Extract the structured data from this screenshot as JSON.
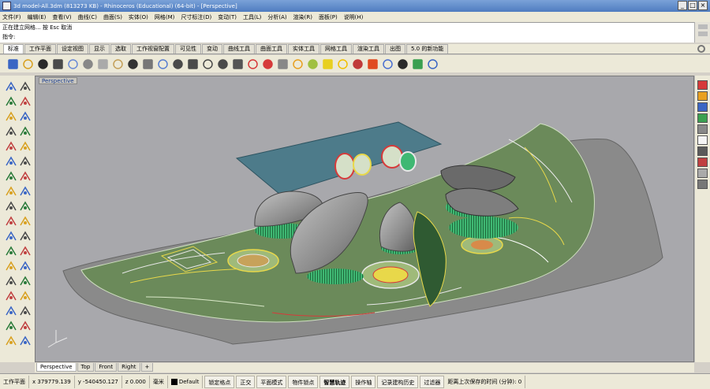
{
  "window": {
    "title": "3d model-All.3dm (813273 KB) - Rhinoceros (Educational) (64-bit) - [Perspective]",
    "controls": [
      "_",
      "□",
      "×"
    ]
  },
  "menu": [
    "文件(F)",
    "编辑(E)",
    "查看(V)",
    "曲线(C)",
    "曲面(S)",
    "实体(O)",
    "网格(M)",
    "尺寸标注(D)",
    "变动(T)",
    "工具(L)",
    "分析(A)",
    "渲染(R)",
    "面板(P)",
    "说明(H)"
  ],
  "command": {
    "history": "正在建立网格... 按 Esc 取消",
    "prompt": "指令:"
  },
  "tabs": [
    "标准",
    "工作平面",
    "设定视图",
    "显示",
    "选取",
    "工作视窗配置",
    "可见性",
    "变动",
    "曲线工具",
    "曲面工具",
    "实体工具",
    "网格工具",
    "渲染工具",
    "出图",
    "5.0 的新功能"
  ],
  "active_tab": "标准",
  "toolbar_icons": [
    "new-file-icon",
    "open-folder-icon",
    "save-icon",
    "print-icon",
    "import-icon",
    "cut-icon",
    "copy-icon",
    "paste-icon",
    "undo-icon",
    "pan-hand-icon",
    "rotate-view-icon",
    "zoom-icon",
    "zoom-window-icon",
    "zoom-extents-icon",
    "zoom-selected-icon",
    "orbit-icon",
    "four-views-icon",
    "grid-icon",
    "point-icon",
    "curve-icon",
    "circle-icon",
    "light-icon",
    "bulb-icon",
    "render-icon",
    "color-wheel-icon",
    "sphere-icon",
    "material-icon",
    "plugin-icon",
    "help-icon"
  ],
  "viewport": {
    "label": "Perspective",
    "tabs": [
      "Perspective",
      "Top",
      "Front",
      "Right",
      "+"
    ],
    "active_tab": "Perspective"
  },
  "status": {
    "cplane": "工作平面",
    "x": "x 379779.139",
    "y": "y -540450.127",
    "z": "z 0.000",
    "units": "毫米",
    "layer": "Default",
    "toggles": [
      "锁定格点",
      "正交",
      "平面模式",
      "物件锁点",
      "智慧轨迹",
      "操作轴",
      "记录建构历史",
      "过滤器"
    ],
    "active_toggles": [
      "智慧轨迹"
    ],
    "message": "距离上次保存的时间 (分钟): 0"
  },
  "colors": {
    "background_gray": "#a8a8ac",
    "platform": "#8a8a8a",
    "site_green": "#6b8a5a",
    "water": "#4d7b8a",
    "building_shell": "#9a9a9a",
    "facade_green": "#3fb873",
    "highlight_yellow": "#e8d84a",
    "highlight_red": "#d63a3a"
  }
}
